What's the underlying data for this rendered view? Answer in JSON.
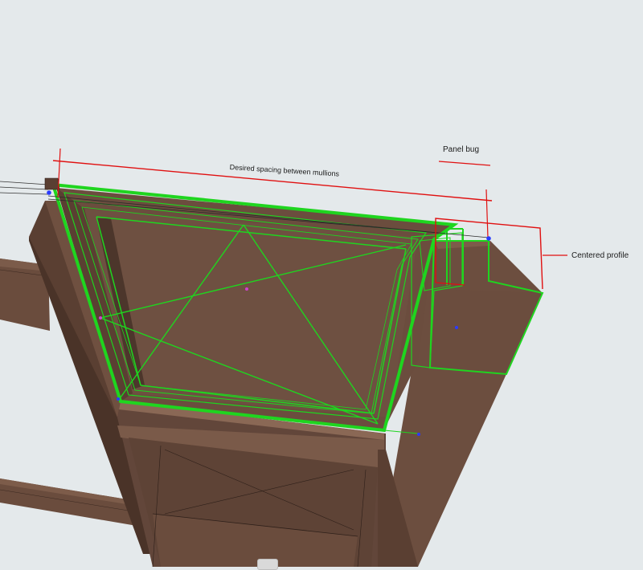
{
  "annotations": {
    "spacing_label": "Desired spacing between mullions",
    "panel_bug_label": "Panel bug",
    "centered_profile_label": "Centered profile"
  },
  "colors": {
    "background": "#e4e9eb",
    "wood_face": "#6b4d3e",
    "wood_dark": "#4e372c",
    "wood_light": "#7a5a49",
    "selection": "#1fd51f",
    "dimension_line": "#e01010",
    "handle_blue": "#2a3bff",
    "handle_magenta": "#d040d0"
  }
}
